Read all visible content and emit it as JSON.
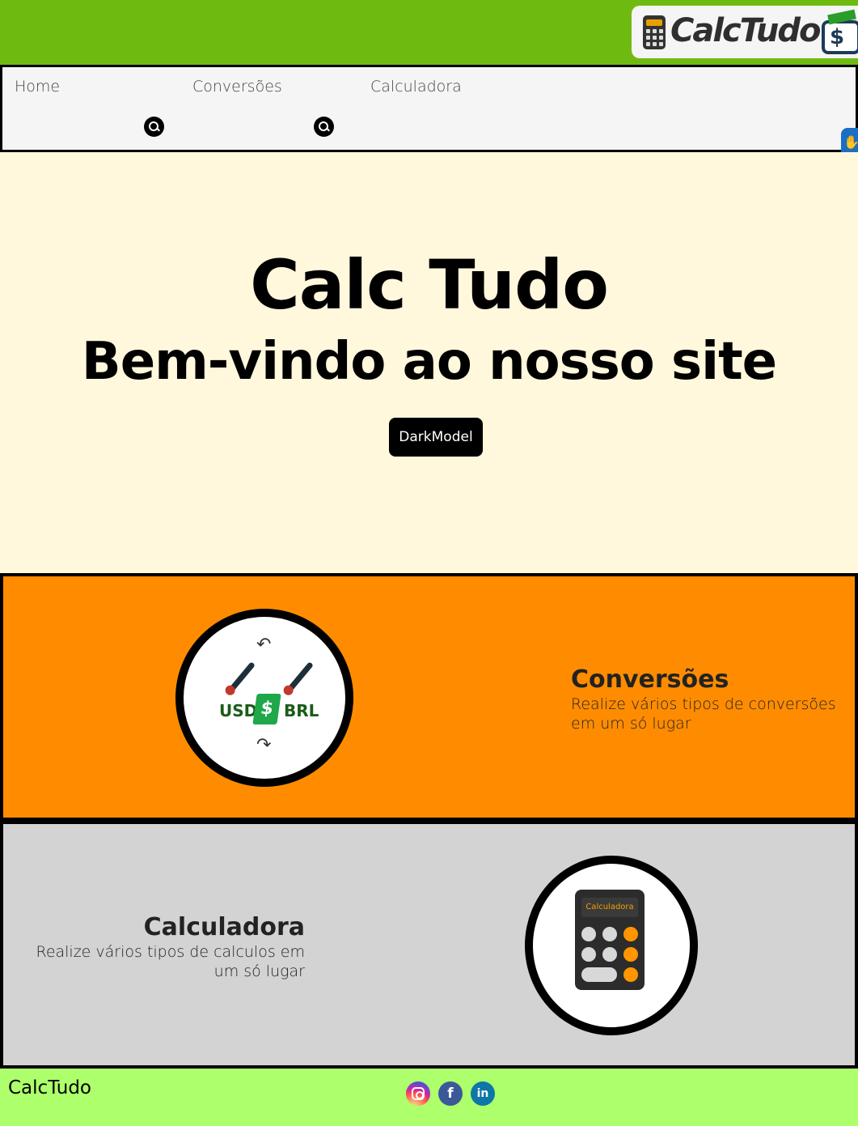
{
  "header": {
    "logo_text": "CalcTudo"
  },
  "nav": {
    "items": [
      {
        "label": "Home"
      },
      {
        "label": "Conversões"
      },
      {
        "label": "Calculadora"
      }
    ]
  },
  "hero": {
    "title": "Calc Tudo",
    "subtitle": "Bem-vindo ao nosso site",
    "dark_button": "DarkModel"
  },
  "sections": {
    "conversions": {
      "title": "Conversões",
      "description_line1": "Realize vários tipos de conversões",
      "description_line2": "em um só lugar",
      "icon_left": "USD",
      "icon_right": "BRL",
      "icon_money": "$"
    },
    "calculator": {
      "title": "Calculadora",
      "description_line1": "Realize vários tipos de calculos em",
      "description_line2": "um só lugar",
      "icon_screen": "Calculadora"
    }
  },
  "footer": {
    "brand": "CalcTudo",
    "social": [
      "instagram-icon",
      "facebook-icon",
      "linkedin-icon"
    ]
  },
  "colors": {
    "topbar": "#6fba10",
    "hero_bg": "#fff8dc",
    "conversions_bg": "#ff8c00",
    "calculator_bg": "#d3d3d3",
    "footer_bg": "#adff6b"
  }
}
